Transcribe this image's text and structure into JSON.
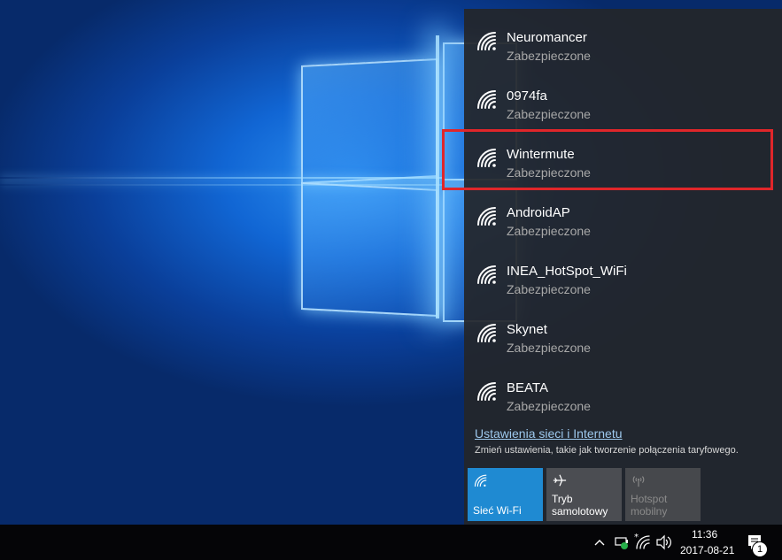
{
  "networks": [
    {
      "name": "Neuromancer",
      "status": "Zabezpieczone"
    },
    {
      "name": "0974fa",
      "status": "Zabezpieczone"
    },
    {
      "name": "Wintermute",
      "status": "Zabezpieczone"
    },
    {
      "name": "AndroidAP",
      "status": "Zabezpieczone"
    },
    {
      "name": "INEA_HotSpot_WiFi",
      "status": "Zabezpieczone"
    },
    {
      "name": "Skynet",
      "status": "Zabezpieczone"
    },
    {
      "name": "BEATA",
      "status": "Zabezpieczone"
    }
  ],
  "settings": {
    "link": "Ustawienia sieci i Internetu",
    "description": "Zmień ustawienia, takie jak tworzenie połączenia taryfowego."
  },
  "tiles": {
    "wifi": {
      "label": "Sieć Wi-Fi",
      "icon": "wifi-icon",
      "active": true
    },
    "airplane": {
      "line1": "Tryb",
      "line2": "samolotowy",
      "icon": "airplane-icon"
    },
    "hotspot": {
      "line1": "Hotspot",
      "line2": "mobilny",
      "icon": "hotspot-icon",
      "disabled": true
    }
  },
  "taskbar": {
    "time": "11:36",
    "date": "2017-08-21",
    "notifications": "1"
  },
  "colors": {
    "accent": "#1f8ad2",
    "highlight": "#e0262a",
    "flyout": "#23262a"
  }
}
